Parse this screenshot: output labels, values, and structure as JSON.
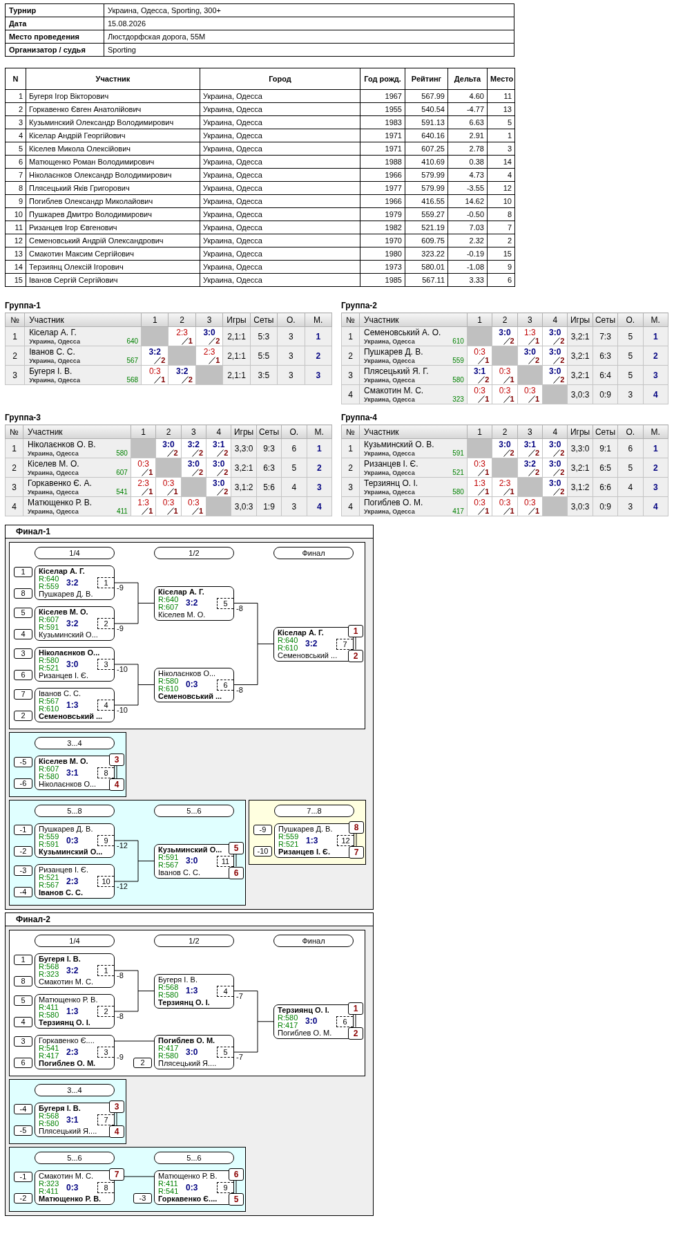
{
  "info": [
    {
      "label": "Турнир",
      "value": "Украина, Одесса, Sporting, 300+"
    },
    {
      "label": "Дата",
      "value": "15.08.2026"
    },
    {
      "label": "Место проведения",
      "value": "Люстдорфская дорога, 55М"
    },
    {
      "label": "Организатор / судья",
      "value": "Sporting"
    }
  ],
  "participants": {
    "columns": [
      "N",
      "Участник",
      "Город",
      "Год рожд.",
      "Рейтинг",
      "Дельта",
      "Место"
    ],
    "rows": [
      {
        "no": "1",
        "name": "Бугеря Ігор Вікторович",
        "city": "Украина, Одесса",
        "year": "1967",
        "rating": "567.99",
        "delta": "4.60",
        "place": "11"
      },
      {
        "no": "2",
        "name": "Горкавенко Євген Анатолійович",
        "city": "Украина, Одесса",
        "year": "1955",
        "rating": "540.54",
        "delta": "-4.77",
        "place": "13"
      },
      {
        "no": "3",
        "name": "Кузьминский Олександр Володимирович",
        "city": "Украина, Одесса",
        "year": "1983",
        "rating": "591.13",
        "delta": "6.63",
        "place": "5"
      },
      {
        "no": "4",
        "name": "Кіселар Андрій Георгійович",
        "city": "Украина, Одесса",
        "year": "1971",
        "rating": "640.16",
        "delta": "2.91",
        "place": "1"
      },
      {
        "no": "5",
        "name": "Кіселев Микола Олексійович",
        "city": "Украина, Одесса",
        "year": "1971",
        "rating": "607.25",
        "delta": "2.78",
        "place": "3"
      },
      {
        "no": "6",
        "name": "Матющенко Роман Володимирович",
        "city": "Украина, Одесса",
        "year": "1988",
        "rating": "410.69",
        "delta": "0.38",
        "place": "14"
      },
      {
        "no": "7",
        "name": "Ніколаєнков Олександр Володимирович",
        "city": "Украина, Одесса",
        "year": "1966",
        "rating": "579.99",
        "delta": "4.73",
        "place": "4"
      },
      {
        "no": "8",
        "name": "Плясецький Яків Григорович",
        "city": "Украина, Одесса",
        "year": "1977",
        "rating": "579.99",
        "delta": "-3.55",
        "place": "12"
      },
      {
        "no": "9",
        "name": "Погиблев Олександр Миколайович",
        "city": "Украина, Одесса",
        "year": "1966",
        "rating": "416.55",
        "delta": "14.62",
        "place": "10"
      },
      {
        "no": "10",
        "name": "Пушкарев Дмитро Володимирович",
        "city": "Украина, Одесса",
        "year": "1979",
        "rating": "559.27",
        "delta": "-0.50",
        "place": "8"
      },
      {
        "no": "11",
        "name": "Ризанцев Ігор Євгенович",
        "city": "Украина, Одесса",
        "year": "1982",
        "rating": "521.19",
        "delta": "7.03",
        "place": "7"
      },
      {
        "no": "12",
        "name": "Семеновський Андрій Олександрович",
        "city": "Украина, Одесса",
        "year": "1970",
        "rating": "609.75",
        "delta": "2.32",
        "place": "2"
      },
      {
        "no": "13",
        "name": "Смакотин Максим Сергійович",
        "city": "Украина, Одесса",
        "year": "1980",
        "rating": "323.22",
        "delta": "-0.19",
        "place": "15"
      },
      {
        "no": "14",
        "name": "Терзиянц Олексій Ігорович",
        "city": "Украина, Одесса",
        "year": "1973",
        "rating": "580.01",
        "delta": "-1.08",
        "place": "9"
      },
      {
        "no": "15",
        "name": "Іванов Сергій Сергійович",
        "city": "Украина, Одесса",
        "year": "1985",
        "rating": "567.11",
        "delta": "3.33",
        "place": "6"
      }
    ]
  },
  "groups": [
    {
      "title": "Группа-1",
      "columns": [
        "№",
        "Участник",
        "1",
        "2",
        "3",
        "Игры",
        "Сеты",
        "О.",
        "М."
      ],
      "rows": [
        {
          "cells": [
            {
              "kind": "text",
              "text": "1"
            },
            {
              "kind": "participant",
              "name": "Кіселар А. Г.",
              "city": "Украина, Одесса",
              "rating": "640"
            },
            {
              "kind": "self"
            },
            {
              "kind": "result",
              "score": "2:3",
              "win": false,
              "points": "1"
            },
            {
              "kind": "result",
              "score": "3:0",
              "win": true,
              "points": "2"
            },
            {
              "kind": "text",
              "text": "2,1:1"
            },
            {
              "kind": "text",
              "text": "5:3"
            },
            {
              "kind": "text",
              "text": "3"
            },
            {
              "kind": "rank",
              "text": "1"
            }
          ]
        },
        {
          "cells": [
            {
              "kind": "text",
              "text": "2"
            },
            {
              "kind": "participant",
              "name": "Іванов С. С.",
              "city": "Украина, Одесса",
              "rating": "567"
            },
            {
              "kind": "result",
              "score": "3:2",
              "win": true,
              "points": "2"
            },
            {
              "kind": "self"
            },
            {
              "kind": "result",
              "score": "2:3",
              "win": false,
              "points": "1"
            },
            {
              "kind": "text",
              "text": "2,1:1"
            },
            {
              "kind": "text",
              "text": "5:5"
            },
            {
              "kind": "text",
              "text": "3"
            },
            {
              "kind": "rank",
              "text": "2"
            }
          ]
        },
        {
          "cells": [
            {
              "kind": "text",
              "text": "3"
            },
            {
              "kind": "participant",
              "name": "Бугеря І. В.",
              "city": "Украина, Одесса",
              "rating": "568"
            },
            {
              "kind": "result",
              "score": "0:3",
              "win": false,
              "points": "1"
            },
            {
              "kind": "result",
              "score": "3:2",
              "win": true,
              "points": "2"
            },
            {
              "kind": "self"
            },
            {
              "kind": "text",
              "text": "2,1:1"
            },
            {
              "kind": "text",
              "text": "3:5"
            },
            {
              "kind": "text",
              "text": "3"
            },
            {
              "kind": "rank",
              "text": "3"
            }
          ]
        }
      ]
    },
    {
      "title": "Группа-2",
      "columns": [
        "№",
        "Участник",
        "1",
        "2",
        "3",
        "4",
        "Игры",
        "Сеты",
        "О.",
        "М."
      ],
      "rows": [
        {
          "cells": [
            {
              "kind": "text",
              "text": "1"
            },
            {
              "kind": "participant",
              "name": "Семеновський А. О.",
              "city": "Украина, Одесса",
              "rating": "610"
            },
            {
              "kind": "self"
            },
            {
              "kind": "result",
              "score": "3:0",
              "win": true,
              "points": "2"
            },
            {
              "kind": "result",
              "score": "1:3",
              "win": false,
              "points": "1"
            },
            {
              "kind": "result",
              "score": "3:0",
              "win": true,
              "points": "2"
            },
            {
              "kind": "text",
              "text": "3,2:1"
            },
            {
              "kind": "text",
              "text": "7:3"
            },
            {
              "kind": "text",
              "text": "5"
            },
            {
              "kind": "rank",
              "text": "1"
            }
          ]
        },
        {
          "cells": [
            {
              "kind": "text",
              "text": "2"
            },
            {
              "kind": "participant",
              "name": "Пушкарев Д. В.",
              "city": "Украина, Одесса",
              "rating": "559"
            },
            {
              "kind": "result",
              "score": "0:3",
              "win": false,
              "points": "1"
            },
            {
              "kind": "self"
            },
            {
              "kind": "result",
              "score": "3:0",
              "win": true,
              "points": "2"
            },
            {
              "kind": "result",
              "score": "3:0",
              "win": true,
              "points": "2"
            },
            {
              "kind": "text",
              "text": "3,2:1"
            },
            {
              "kind": "text",
              "text": "6:3"
            },
            {
              "kind": "text",
              "text": "5"
            },
            {
              "kind": "rank",
              "text": "2"
            }
          ]
        },
        {
          "cells": [
            {
              "kind": "text",
              "text": "3"
            },
            {
              "kind": "participant",
              "name": "Плясецький Я. Г.",
              "city": "Украина, Одесса",
              "rating": "580"
            },
            {
              "kind": "result",
              "score": "3:1",
              "win": true,
              "points": "2"
            },
            {
              "kind": "result",
              "score": "0:3",
              "win": false,
              "points": "1"
            },
            {
              "kind": "self"
            },
            {
              "kind": "result",
              "score": "3:0",
              "win": true,
              "points": "2"
            },
            {
              "kind": "text",
              "text": "3,2:1"
            },
            {
              "kind": "text",
              "text": "6:4"
            },
            {
              "kind": "text",
              "text": "5"
            },
            {
              "kind": "rank",
              "text": "3"
            }
          ]
        },
        {
          "cells": [
            {
              "kind": "text",
              "text": "4"
            },
            {
              "kind": "participant",
              "name": "Смакотин М. С.",
              "city": "Украина, Одесса",
              "rating": "323"
            },
            {
              "kind": "result",
              "score": "0:3",
              "win": false,
              "points": "1"
            },
            {
              "kind": "result",
              "score": "0:3",
              "win": false,
              "points": "1"
            },
            {
              "kind": "result",
              "score": "0:3",
              "win": false,
              "points": "1"
            },
            {
              "kind": "self"
            },
            {
              "kind": "text",
              "text": "3,0:3"
            },
            {
              "kind": "text",
              "text": "0:9"
            },
            {
              "kind": "text",
              "text": "3"
            },
            {
              "kind": "rank",
              "text": "4"
            }
          ]
        }
      ]
    },
    {
      "title": "Группа-3",
      "columns": [
        "№",
        "Участник",
        "1",
        "2",
        "3",
        "4",
        "Игры",
        "Сеты",
        "О.",
        "М."
      ],
      "rows": [
        {
          "cells": [
            {
              "kind": "text",
              "text": "1"
            },
            {
              "kind": "participant",
              "name": "Ніколаєнков О. В.",
              "city": "Украина, Одесса",
              "rating": "580"
            },
            {
              "kind": "self"
            },
            {
              "kind": "result",
              "score": "3:0",
              "win": true,
              "points": "2"
            },
            {
              "kind": "result",
              "score": "3:2",
              "win": true,
              "points": "2"
            },
            {
              "kind": "result",
              "score": "3:1",
              "win": true,
              "points": "2"
            },
            {
              "kind": "text",
              "text": "3,3:0"
            },
            {
              "kind": "text",
              "text": "9:3"
            },
            {
              "kind": "text",
              "text": "6"
            },
            {
              "kind": "rank",
              "text": "1"
            }
          ]
        },
        {
          "cells": [
            {
              "kind": "text",
              "text": "2"
            },
            {
              "kind": "participant",
              "name": "Кіселев М. О.",
              "city": "Украина, Одесса",
              "rating": "607"
            },
            {
              "kind": "result",
              "score": "0:3",
              "win": false,
              "points": "1"
            },
            {
              "kind": "self"
            },
            {
              "kind": "result",
              "score": "3:0",
              "win": true,
              "points": "2"
            },
            {
              "kind": "result",
              "score": "3:0",
              "win": true,
              "points": "2"
            },
            {
              "kind": "text",
              "text": "3,2:1"
            },
            {
              "kind": "text",
              "text": "6:3"
            },
            {
              "kind": "text",
              "text": "5"
            },
            {
              "kind": "rank",
              "text": "2"
            }
          ]
        },
        {
          "cells": [
            {
              "kind": "text",
              "text": "3"
            },
            {
              "kind": "participant",
              "name": "Горкавенко Є. А.",
              "city": "Украина, Одесса",
              "rating": "541"
            },
            {
              "kind": "result",
              "score": "2:3",
              "win": false,
              "points": "1"
            },
            {
              "kind": "result",
              "score": "0:3",
              "win": false,
              "points": "1"
            },
            {
              "kind": "self"
            },
            {
              "kind": "result",
              "score": "3:0",
              "win": true,
              "points": "2"
            },
            {
              "kind": "text",
              "text": "3,1:2"
            },
            {
              "kind": "text",
              "text": "5:6"
            },
            {
              "kind": "text",
              "text": "4"
            },
            {
              "kind": "rank",
              "text": "3"
            }
          ]
        },
        {
          "cells": [
            {
              "kind": "text",
              "text": "4"
            },
            {
              "kind": "participant",
              "name": "Матющенко Р. В.",
              "city": "Украина, Одесса",
              "rating": "411"
            },
            {
              "kind": "result",
              "score": "1:3",
              "win": false,
              "points": "1"
            },
            {
              "kind": "result",
              "score": "0:3",
              "win": false,
              "points": "1"
            },
            {
              "kind": "result",
              "score": "0:3",
              "win": false,
              "points": "1"
            },
            {
              "kind": "self"
            },
            {
              "kind": "text",
              "text": "3,0:3"
            },
            {
              "kind": "text",
              "text": "1:9"
            },
            {
              "kind": "text",
              "text": "3"
            },
            {
              "kind": "rank",
              "text": "4"
            }
          ]
        }
      ]
    },
    {
      "title": "Группа-4",
      "columns": [
        "№",
        "Участник",
        "1",
        "2",
        "3",
        "4",
        "Игры",
        "Сеты",
        "О.",
        "М."
      ],
      "rows": [
        {
          "cells": [
            {
              "kind": "text",
              "text": "1"
            },
            {
              "kind": "participant",
              "name": "Кузьминский О. В.",
              "city": "Украина, Одесса",
              "rating": "591"
            },
            {
              "kind": "self"
            },
            {
              "kind": "result",
              "score": "3:0",
              "win": true,
              "points": "2"
            },
            {
              "kind": "result",
              "score": "3:1",
              "win": true,
              "points": "2"
            },
            {
              "kind": "result",
              "score": "3:0",
              "win": true,
              "points": "2"
            },
            {
              "kind": "text",
              "text": "3,3:0"
            },
            {
              "kind": "text",
              "text": "9:1"
            },
            {
              "kind": "text",
              "text": "6"
            },
            {
              "kind": "rank",
              "text": "1"
            }
          ]
        },
        {
          "cells": [
            {
              "kind": "text",
              "text": "2"
            },
            {
              "kind": "participant",
              "name": "Ризанцев І. Є.",
              "city": "Украина, Одесса",
              "rating": "521"
            },
            {
              "kind": "result",
              "score": "0:3",
              "win": false,
              "points": "1"
            },
            {
              "kind": "self"
            },
            {
              "kind": "result",
              "score": "3:2",
              "win": true,
              "points": "2"
            },
            {
              "kind": "result",
              "score": "3:0",
              "win": true,
              "points": "2"
            },
            {
              "kind": "text",
              "text": "3,2:1"
            },
            {
              "kind": "text",
              "text": "6:5"
            },
            {
              "kind": "text",
              "text": "5"
            },
            {
              "kind": "rank",
              "text": "2"
            }
          ]
        },
        {
          "cells": [
            {
              "kind": "text",
              "text": "3"
            },
            {
              "kind": "participant",
              "name": "Терзиянц О. І.",
              "city": "Украина, Одесса",
              "rating": "580"
            },
            {
              "kind": "result",
              "score": "1:3",
              "win": false,
              "points": "1"
            },
            {
              "kind": "result",
              "score": "2:3",
              "win": false,
              "points": "1"
            },
            {
              "kind": "self"
            },
            {
              "kind": "result",
              "score": "3:0",
              "win": true,
              "points": "2"
            },
            {
              "kind": "text",
              "text": "3,1:2"
            },
            {
              "kind": "text",
              "text": "6:6"
            },
            {
              "kind": "text",
              "text": "4"
            },
            {
              "kind": "rank",
              "text": "3"
            }
          ]
        },
        {
          "cells": [
            {
              "kind": "text",
              "text": "4"
            },
            {
              "kind": "participant",
              "name": "Погиблев О. М.",
              "city": "Украина, Одесса",
              "rating": "417"
            },
            {
              "kind": "result",
              "score": "0:3",
              "win": false,
              "points": "1"
            },
            {
              "kind": "result",
              "score": "0:3",
              "win": false,
              "points": "1"
            },
            {
              "kind": "result",
              "score": "0:3",
              "win": false,
              "points": "1"
            },
            {
              "kind": "self"
            },
            {
              "kind": "text",
              "text": "3,0:3"
            },
            {
              "kind": "text",
              "text": "0:9"
            },
            {
              "kind": "text",
              "text": "3"
            },
            {
              "kind": "rank",
              "text": "4"
            }
          ]
        }
      ]
    }
  ],
  "finals": [
    {
      "title": "Финал-1",
      "rows": [
        [
          {
            "color": "#ffffff",
            "rounds": [
              {
                "label": "1/4",
                "matches": [
                  {
                    "number": "1",
                    "score": "3:2",
                    "loser_to": "-9",
                    "players": [
                      {
                        "name": "Кіселар А. Г.",
                        "rating": "R:640",
                        "winner": true,
                        "seed": "1"
                      },
                      {
                        "name": "Пушкарев Д. В.",
                        "rating": "R:559",
                        "winner": false,
                        "seed": "8"
                      }
                    ]
                  },
                  {
                    "number": "2",
                    "score": "3:2",
                    "loser_to": "-9",
                    "players": [
                      {
                        "name": "Кіселев М. О.",
                        "rating": "R:607",
                        "winner": true,
                        "seed": "5"
                      },
                      {
                        "name": "Кузьминский О...",
                        "rating": "R:591",
                        "winner": false,
                        "seed": "4"
                      }
                    ]
                  },
                  {
                    "number": "3",
                    "score": "3:0",
                    "loser_to": "-10",
                    "players": [
                      {
                        "name": "Ніколаєнков О...",
                        "rating": "R:580",
                        "winner": true,
                        "seed": "3"
                      },
                      {
                        "name": "Ризанцев І. Є.",
                        "rating": "R:521",
                        "winner": false,
                        "seed": "6"
                      }
                    ]
                  },
                  {
                    "number": "4",
                    "score": "1:3",
                    "loser_to": "-10",
                    "players": [
                      {
                        "name": "Іванов С. С.",
                        "rating": "R:567",
                        "winner": false,
                        "seed": "7"
                      },
                      {
                        "name": "Семеновський ...",
                        "rating": "R:610",
                        "winner": true,
                        "seed": "2"
                      }
                    ]
                  }
                ]
              },
              {
                "label": "1/2",
                "matches": [
                  {
                    "number": "5",
                    "score": "3:2",
                    "loser_to": "-8",
                    "players": [
                      {
                        "name": "Кіселар А. Г.",
                        "rating": "R:640",
                        "winner": true
                      },
                      {
                        "name": "Кіселев М. О.",
                        "rating": "R:607",
                        "winner": false
                      }
                    ]
                  },
                  {
                    "number": "6",
                    "score": "0:3",
                    "loser_to": "-8",
                    "players": [
                      {
                        "name": "Ніколаєнков О...",
                        "rating": "R:580",
                        "winner": false
                      },
                      {
                        "name": "Семеновський ...",
                        "rating": "R:610",
                        "winner": true
                      }
                    ]
                  }
                ]
              },
              {
                "label": "Финал",
                "matches": [
                  {
                    "number": "7",
                    "score": "3:2",
                    "players": [
                      {
                        "name": "Кіселар А. Г.",
                        "rating": "R:640",
                        "winner": true,
                        "place": "1"
                      },
                      {
                        "name": "Семеновський ...",
                        "rating": "R:610",
                        "winner": false,
                        "place": "2"
                      }
                    ]
                  }
                ]
              }
            ]
          }
        ],
        [
          {
            "color": "#e0ffff",
            "rounds": [
              {
                "label": "3...4",
                "matches": [
                  {
                    "number": "8",
                    "score": "3:1",
                    "players": [
                      {
                        "name": "Кіселев М. О.",
                        "rating": "R:607",
                        "winner": true,
                        "seed": "-5",
                        "place": "3"
                      },
                      {
                        "name": "Ніколаєнков О...",
                        "rating": "R:580",
                        "winner": false,
                        "seed": "-6",
                        "place": "4"
                      }
                    ]
                  }
                ]
              }
            ]
          }
        ],
        [
          {
            "color": "#e0ffff",
            "rounds": [
              {
                "label": "5...8",
                "matches": [
                  {
                    "number": "9",
                    "score": "0:3",
                    "loser_to": "-12",
                    "players": [
                      {
                        "name": "Пушкарев Д. В.",
                        "rating": "R:559",
                        "winner": false,
                        "seed": "-1"
                      },
                      {
                        "name": "Кузьминский О...",
                        "rating": "R:591",
                        "winner": true,
                        "seed": "-2"
                      }
                    ]
                  },
                  {
                    "number": "10",
                    "score": "2:3",
                    "loser_to": "-12",
                    "players": [
                      {
                        "name": "Ризанцев І. Є.",
                        "rating": "R:521",
                        "winner": false,
                        "seed": "-3"
                      },
                      {
                        "name": "Іванов С. С.",
                        "rating": "R:567",
                        "winner": true,
                        "seed": "-4"
                      }
                    ]
                  }
                ]
              },
              {
                "label": "5...6",
                "matches": [
                  {
                    "number": "11",
                    "score": "3:0",
                    "players": [
                      {
                        "name": "Кузьминский О...",
                        "rating": "R:591",
                        "winner": true,
                        "place": "5"
                      },
                      {
                        "name": "Іванов С. С.",
                        "rating": "R:567",
                        "winner": false,
                        "place": "6"
                      }
                    ]
                  }
                ]
              }
            ]
          },
          {
            "color": "#ffffe0",
            "rounds": [
              {
                "label": "7...8",
                "matches": [
                  {
                    "number": "12",
                    "score": "1:3",
                    "players": [
                      {
                        "name": "Пушкарев Д. В.",
                        "rating": "R:559",
                        "winner": false,
                        "seed": "-9",
                        "place": "8"
                      },
                      {
                        "name": "Ризанцев І. Є.",
                        "rating": "R:521",
                        "winner": true,
                        "seed": "-10",
                        "place": "7"
                      }
                    ]
                  }
                ]
              }
            ]
          }
        ]
      ]
    },
    {
      "title": "Финал-2",
      "rows": [
        [
          {
            "color": "#ffffff",
            "rounds": [
              {
                "label": "1/4",
                "matches": [
                  {
                    "number": "1",
                    "score": "3:2",
                    "loser_to": "-8",
                    "players": [
                      {
                        "name": "Бугеря І. В.",
                        "rating": "R:568",
                        "winner": true,
                        "seed": "1"
                      },
                      {
                        "name": "Смакотин М. С.",
                        "rating": "R:323",
                        "winner": false,
                        "seed": "8"
                      }
                    ]
                  },
                  {
                    "number": "2",
                    "score": "1:3",
                    "loser_to": "-8",
                    "players": [
                      {
                        "name": "Матющенко Р. В.",
                        "rating": "R:411",
                        "winner": false,
                        "seed": "5"
                      },
                      {
                        "name": "Терзиянц О. І.",
                        "rating": "R:580",
                        "winner": true,
                        "seed": "4"
                      }
                    ]
                  },
                  {
                    "number": "3",
                    "score": "2:3",
                    "loser_to": "-9",
                    "players": [
                      {
                        "name": "Горкавенко Є....",
                        "rating": "R:541",
                        "winner": false,
                        "seed": "3"
                      },
                      {
                        "name": "Погиблев О. М.",
                        "rating": "R:417",
                        "winner": true,
                        "seed": "6"
                      }
                    ]
                  }
                ]
              },
              {
                "label": "1/2",
                "matches": [
                  {
                    "number": "4",
                    "score": "1:3",
                    "loser_to": "-7",
                    "players": [
                      {
                        "name": "Бугеря І. В.",
                        "rating": "R:568",
                        "winner": false
                      },
                      {
                        "name": "Терзиянц О. І.",
                        "rating": "R:580",
                        "winner": true
                      }
                    ]
                  },
                  {
                    "number": "5",
                    "score": "3:0",
                    "loser_to": "-7",
                    "players": [
                      {
                        "name": "Погиблев О. М.",
                        "rating": "R:417",
                        "winner": true
                      },
                      {
                        "name": "Плясецький Я....",
                        "rating": "R:580",
                        "winner": false,
                        "seed": "2"
                      }
                    ]
                  }
                ]
              },
              {
                "label": "Финал",
                "matches": [
                  {
                    "number": "6",
                    "score": "3:0",
                    "players": [
                      {
                        "name": "Терзиянц О. І.",
                        "rating": "R:580",
                        "winner": true,
                        "place": "1"
                      },
                      {
                        "name": "Погиблев О. М.",
                        "rating": "R:417",
                        "winner": false,
                        "place": "2"
                      }
                    ]
                  }
                ]
              }
            ]
          }
        ],
        [
          {
            "color": "#e0ffff",
            "rounds": [
              {
                "label": "3...4",
                "matches": [
                  {
                    "number": "7",
                    "score": "3:1",
                    "players": [
                      {
                        "name": "Бугеря І. В.",
                        "rating": "R:568",
                        "winner": true,
                        "seed": "-4",
                        "place": "3"
                      },
                      {
                        "name": "Плясецький Я....",
                        "rating": "R:580",
                        "winner": false,
                        "seed": "-5",
                        "place": "4"
                      }
                    ]
                  }
                ]
              }
            ]
          }
        ],
        [
          {
            "color": "#e0ffff",
            "rounds": [
              {
                "label": "5...6",
                "matches": [
                  {
                    "number": "8",
                    "score": "0:3",
                    "players": [
                      {
                        "name": "Смакотин М. С.",
                        "rating": "R:323",
                        "winner": false,
                        "seed": "-1",
                        "place": "7"
                      },
                      {
                        "name": "Матющенко Р. В.",
                        "rating": "R:411",
                        "winner": true,
                        "seed": "-2"
                      }
                    ]
                  }
                ]
              },
              {
                "label": "5...6",
                "matches": [
                  {
                    "number": "9",
                    "score": "0:3",
                    "players": [
                      {
                        "name": "Матющенко Р. В.",
                        "rating": "R:411",
                        "winner": false,
                        "place": "6"
                      },
                      {
                        "name": "Горкавенко Є....",
                        "rating": "R:541",
                        "winner": true,
                        "seed": "-3",
                        "place": "5"
                      }
                    ]
                  }
                ]
              }
            ]
          }
        ]
      ]
    }
  ]
}
